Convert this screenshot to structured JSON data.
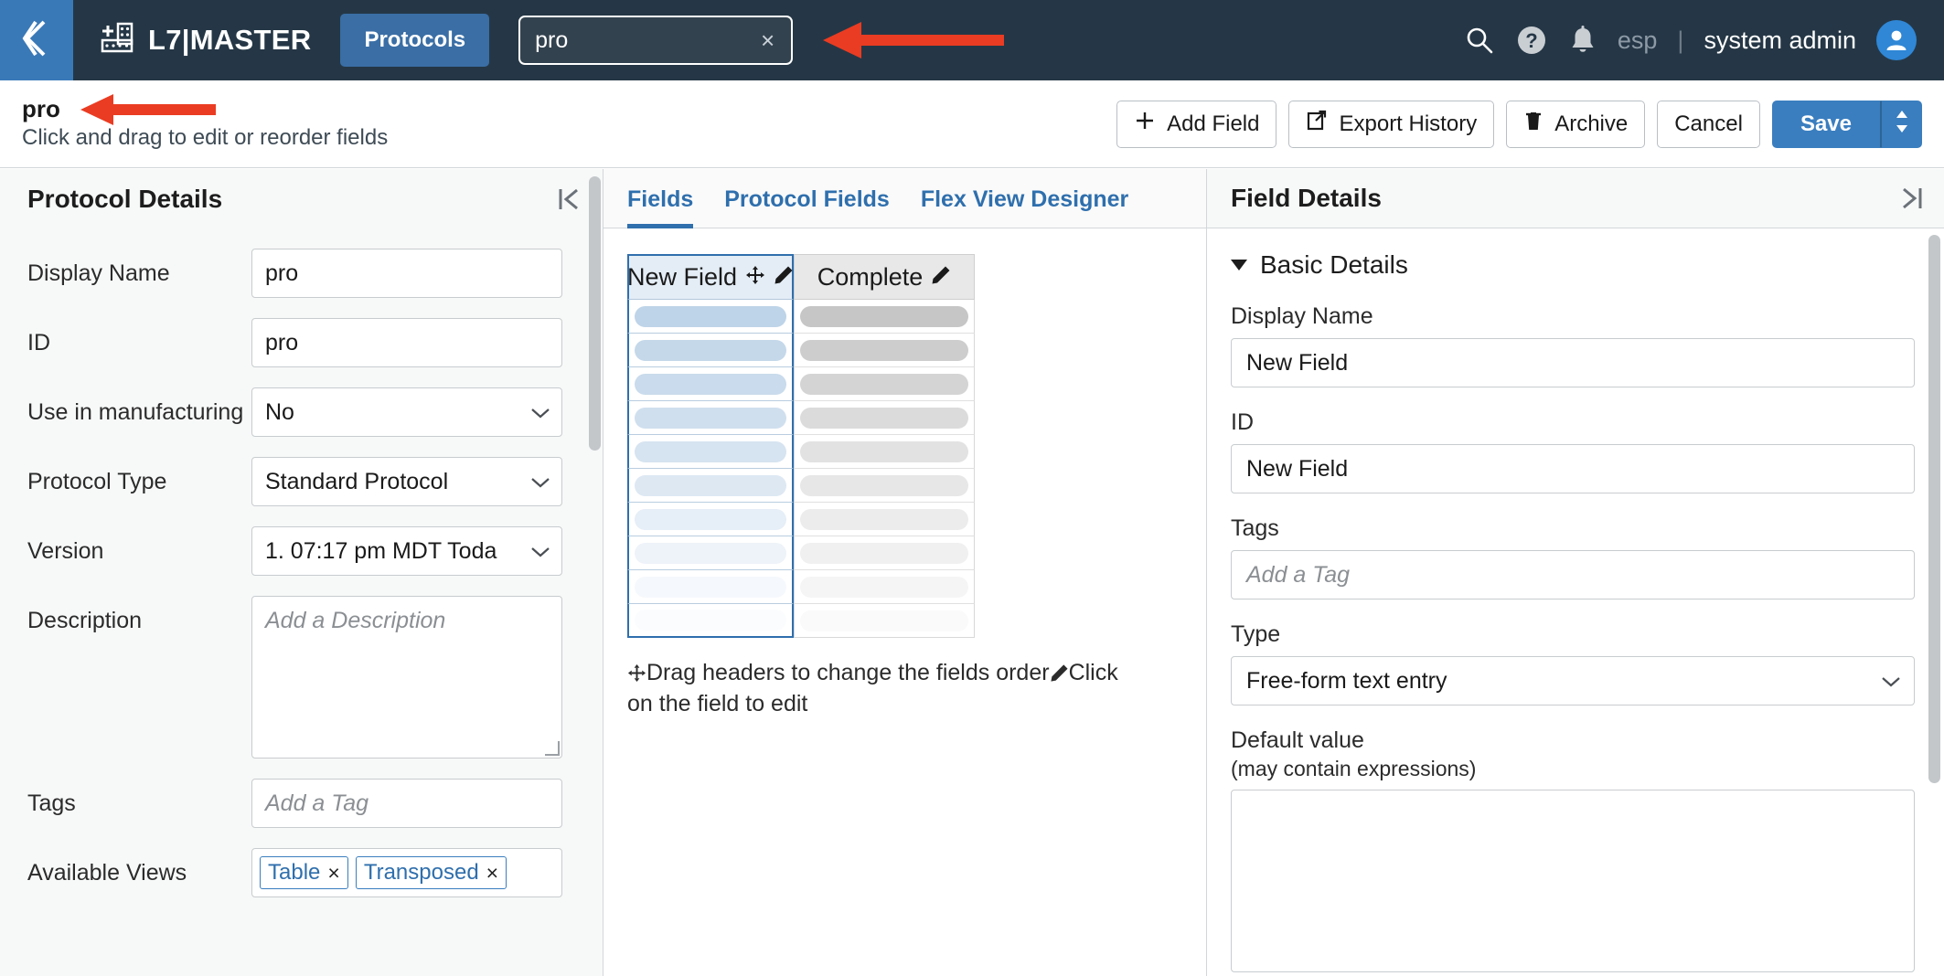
{
  "topbar": {
    "back_icon": "double-chevron-left-icon",
    "logo_icon": "l7-plate-plus-icon",
    "logo_text": "L7|MASTER",
    "nav_pill_label": "Protocols",
    "search": {
      "value": "pro",
      "clear_glyph": "×"
    },
    "icons": [
      "search-icon",
      "help-icon",
      "notifications-bell-icon"
    ],
    "tenant": "esp",
    "separator": "|",
    "user": "system admin",
    "avatar_icon": "user-avatar-icon"
  },
  "actionbar": {
    "title": "pro",
    "subtitle": "Click and drag to edit or reorder fields",
    "buttons": [
      {
        "label": "Add Field",
        "icon": "plus-icon"
      },
      {
        "label": "Export History",
        "icon": "external-link-icon"
      },
      {
        "label": "Archive",
        "icon": "trash-icon"
      },
      {
        "label": "Cancel",
        "icon": ""
      }
    ],
    "save_label": "Save",
    "save_caret_icon": "up-down-caret-icon"
  },
  "left_panel": {
    "title": "Protocol Details",
    "collapse_icon": "collapse-left-icon",
    "fields": {
      "display_name_label": "Display Name",
      "display_name_value": "pro",
      "id_label": "ID",
      "id_value": "pro",
      "use_in_manufacturing_label": "Use in manufacturing",
      "use_in_manufacturing_value": "No",
      "protocol_type_label": "Protocol Type",
      "protocol_type_value": "Standard Protocol",
      "version_label": "Version",
      "version_value": "1. 07:17 pm MDT Toda",
      "description_label": "Description",
      "description_placeholder": "Add a Description",
      "tags_label": "Tags",
      "tags_placeholder": "Add a Tag",
      "available_views_label": "Available Views",
      "available_views": [
        "Table",
        "Transposed"
      ],
      "chip_remove_glyph": "×"
    }
  },
  "center_panel": {
    "tabs": [
      {
        "label": "Fields",
        "active": true
      },
      {
        "label": "Protocol Fields",
        "active": false
      },
      {
        "label": "Flex View Designer",
        "active": false
      }
    ],
    "grid": {
      "columns": [
        {
          "label": "New Field",
          "icons": [
            "move-arrows-icon",
            "pencil-icon"
          ],
          "selected": true
        },
        {
          "label": "Complete",
          "icons": [
            "pencil-icon"
          ],
          "selected": false
        }
      ],
      "row_count": 10
    },
    "hint_part1": "Drag headers to change the fields order",
    "hint_part2": "Click on the field to edit",
    "hint_icon1": "move-arrows-icon",
    "hint_icon2": "pencil-icon"
  },
  "right_panel": {
    "title": "Field Details",
    "collapse_icon": "collapse-right-icon",
    "section_label": "Basic Details",
    "display_name_label": "Display Name",
    "display_name_value": "New Field",
    "id_label": "ID",
    "id_value": "New Field",
    "tags_label": "Tags",
    "tags_placeholder": "Add a Tag",
    "type_label": "Type",
    "type_value": "Free-form text entry",
    "default_value_label": "Default value",
    "default_value_sub": "(may contain expressions)",
    "default_value_text": ""
  },
  "annotations": {
    "arrow_color": "#EA3C22",
    "arrow_search_target": "search-input",
    "arrow_title_target": "page-title"
  },
  "colors": {
    "navbar_bg": "#253746",
    "accent_blue": "#3A7EBF",
    "tab_blue": "#2F6FAD",
    "avatar_blue": "#2F87D6",
    "annotation_red": "#EA3C22"
  }
}
